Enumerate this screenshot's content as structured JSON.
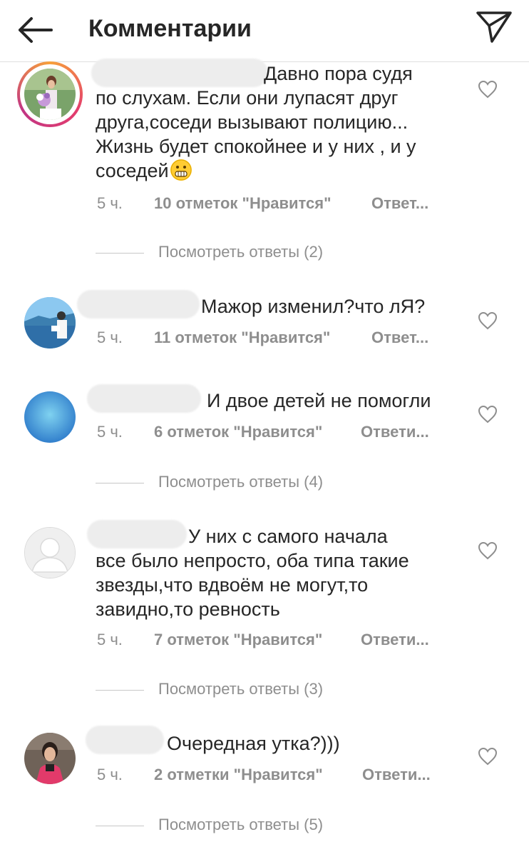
{
  "header": {
    "title": "Комментарии",
    "back_icon": "arrow-left-icon",
    "send_icon": "paper-plane-icon"
  },
  "comments": [
    {
      "text": "Давно пора судя\nпо слухам. Если они лупасят друг\nдруга,соседи вызывают полицию...\nЖизнь будет спокойнее и у них , и у\nсоседей",
      "emoji": "grinning-face-icon",
      "time": "5 ч.",
      "likes": "10 отметок \"Нравится\"",
      "reply": "Ответ...",
      "view_replies": "Посмотреть ответы (2)"
    },
    {
      "text": "Мажор изменил?что лЯ?",
      "time": "5 ч.",
      "likes": "11 отметок \"Нравится\"",
      "reply": "Ответ...",
      "view_replies": ""
    },
    {
      "text": "И двое детей не помогли",
      "time": "5 ч.",
      "likes": "6 отметок \"Нравится\"",
      "reply": "Ответи...",
      "view_replies": "Посмотреть ответы (4)"
    },
    {
      "text": "У них с самого начала\nвсе было непросто, оба типа такие\nзвезды,что вдвоём не могут,то\nзавидно,то ревность",
      "time": "5 ч.",
      "likes": "7 отметок \"Нравится\"",
      "reply": "Ответи...",
      "view_replies": "Посмотреть ответы (3)"
    },
    {
      "text": "Очередная утка?)))",
      "time": "5 ч.",
      "likes": "2 отметки \"Нравится\"",
      "reply": "Ответи...",
      "view_replies": "Посмотреть ответы (5)"
    }
  ],
  "colors": {
    "text": "#262626",
    "secondary": "#8e8e8e",
    "divider": "#c7c7c7",
    "story_ring": "#e43d6d"
  }
}
